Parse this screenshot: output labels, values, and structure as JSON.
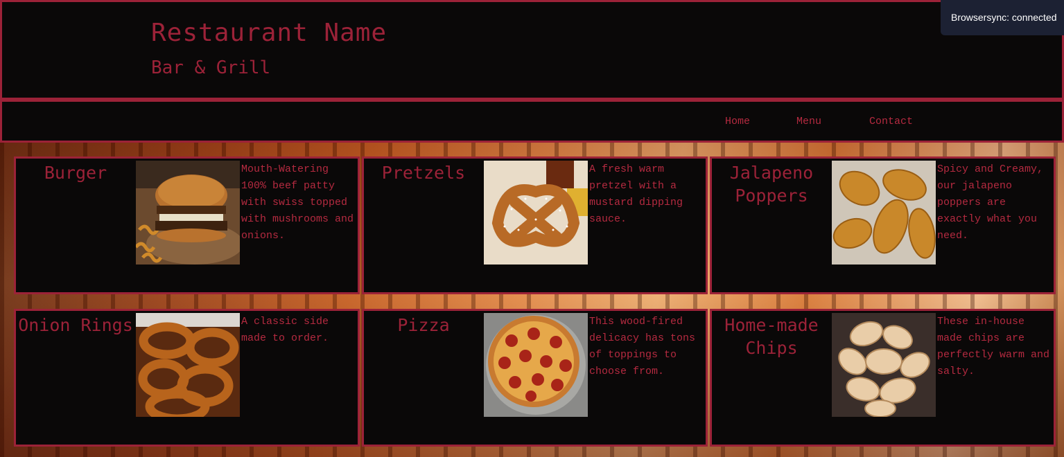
{
  "header": {
    "title": "Restaurant Name",
    "subtitle": "Bar & Grill"
  },
  "nav": {
    "items": [
      {
        "label": "Home"
      },
      {
        "label": "Menu"
      },
      {
        "label": "Contact"
      }
    ]
  },
  "toast": {
    "text": "Browsersync: connected"
  },
  "menu": {
    "items": [
      {
        "name": "Burger",
        "description": "Mouth-Watering 100% beef patty with swiss topped with mushrooms and onions.",
        "image": "burger-photo"
      },
      {
        "name": "Pretzels",
        "description": "A fresh warm pretzel with a mustard dipping sauce.",
        "image": "pretzel-photo"
      },
      {
        "name": "Jalapeno Poppers",
        "description": "Spicy and Creamy, our jalapeno poppers are exactly what you need.",
        "image": "jalapeno-poppers-photo"
      },
      {
        "name": "Onion Rings",
        "description": "A classic side made to order.",
        "image": "onion-rings-photo"
      },
      {
        "name": "Pizza",
        "description": "This wood-fired delicacy has tons of toppings to choose from.",
        "image": "pizza-photo"
      },
      {
        "name": "Home-made Chips",
        "description": "These in-house made chips are perfectly warm and salty.",
        "image": "chips-photo"
      }
    ]
  },
  "colors": {
    "accent": "#9c2238",
    "panel": "#0a0808",
    "toast_bg": "#1c2133"
  }
}
